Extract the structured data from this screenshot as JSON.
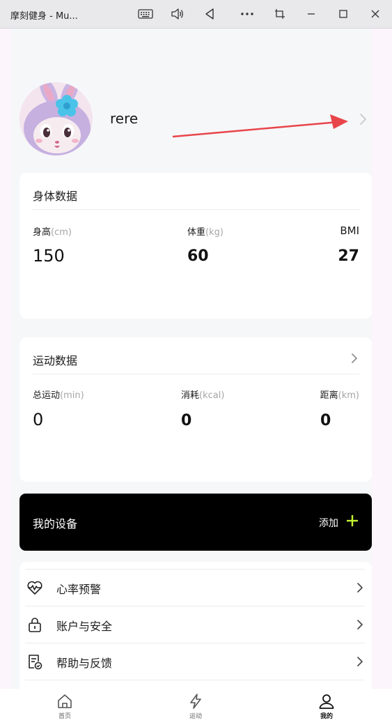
{
  "window": {
    "title": "摩刻健身 - Mu...",
    "controls": [
      "keyboard-icon",
      "volume-icon",
      "back-icon",
      "more-icon",
      "screenshot-icon",
      "minimize-icon",
      "maximize-icon",
      "close-icon"
    ]
  },
  "profile": {
    "username": "rere"
  },
  "body_data": {
    "title": "身体数据",
    "stats": [
      {
        "label": "身高",
        "unit": "(cm)",
        "value": "150"
      },
      {
        "label": "体重",
        "unit": "(kg)",
        "value": "60"
      },
      {
        "label": "BMI",
        "unit": "",
        "value": "27"
      }
    ]
  },
  "sport_data": {
    "title": "运动数据",
    "stats": [
      {
        "label": "总运动",
        "unit": "(min)",
        "value": "0"
      },
      {
        "label": "消耗",
        "unit": "(kcal)",
        "value": "0"
      },
      {
        "label": "距离",
        "unit": "(km)",
        "value": "0"
      }
    ]
  },
  "device": {
    "title": "我的设备",
    "add_label": "添加",
    "accent": "#c6f432"
  },
  "menu": [
    {
      "label": "心率预警",
      "icon": "heart-rate-icon"
    },
    {
      "label": "账户与安全",
      "icon": "lock-icon"
    },
    {
      "label": "帮助与反馈",
      "icon": "feedback-icon"
    }
  ],
  "tabbar": [
    {
      "label": "首页",
      "icon": "home-icon",
      "active": false
    },
    {
      "label": "运动",
      "icon": "lightning-icon",
      "active": false
    },
    {
      "label": "我的",
      "icon": "user-icon",
      "active": true
    }
  ],
  "annotation_color": "#e8454a"
}
